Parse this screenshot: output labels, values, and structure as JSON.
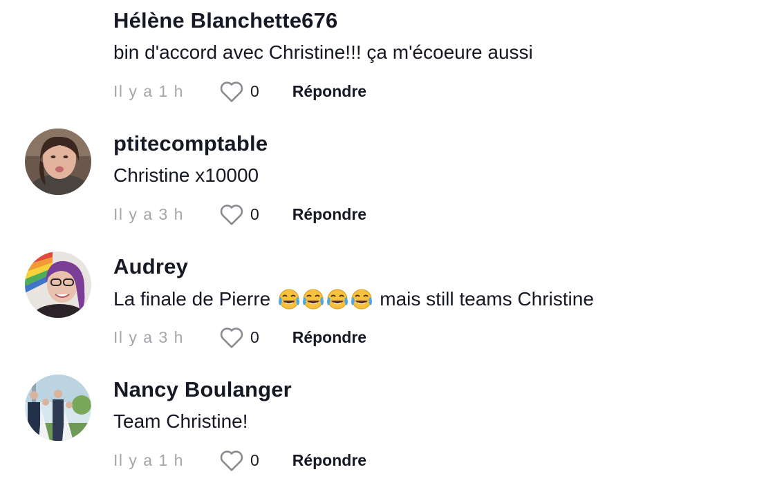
{
  "colors": {
    "text": "#161823",
    "muted": "#a5a6ab",
    "background": "#ffffff"
  },
  "comments": [
    {
      "username": "Hélène Blanchette676",
      "text": "bin d'accord avec Christine!!! ça m'écoeure aussi",
      "time": "Il y a 1 h",
      "likes": "0",
      "reply_label": "Répondre",
      "has_avatar": false
    },
    {
      "username": "ptitecomptable",
      "text": "Christine x10000",
      "time": "Il y a 3 h",
      "likes": "0",
      "reply_label": "Répondre",
      "has_avatar": true
    },
    {
      "username": "Audrey",
      "text_before": "La finale de Pierre",
      "emoji": "😂😂😂😂",
      "text_after": "mais still teams Christine",
      "time": "Il y a 3 h",
      "likes": "0",
      "reply_label": "Répondre",
      "has_avatar": true
    },
    {
      "username": "Nancy Boulanger",
      "text": "Team Christine!",
      "time": "Il y a 1 h",
      "likes": "0",
      "reply_label": "Répondre",
      "has_avatar": true
    }
  ],
  "icons": {
    "like": "heart-outline-icon",
    "emoji": "face-with-tears-of-joy-icon"
  }
}
